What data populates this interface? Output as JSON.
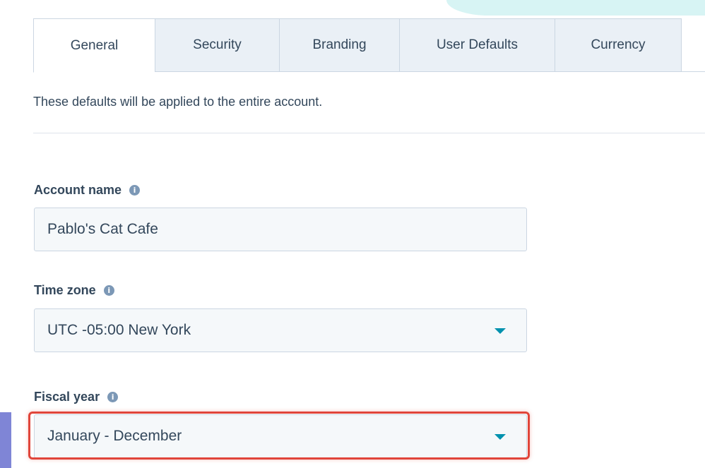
{
  "tabs": [
    {
      "label": "General",
      "active": true
    },
    {
      "label": "Security",
      "active": false
    },
    {
      "label": "Branding",
      "active": false
    },
    {
      "label": "User Defaults",
      "active": false
    },
    {
      "label": "Currency",
      "active": false
    }
  ],
  "intro_text": "These defaults will be applied to the entire account.",
  "account_name": {
    "label": "Account name",
    "value": "Pablo's Cat Cafe",
    "icon": "info-icon"
  },
  "time_zone": {
    "label": "Time zone",
    "value": "UTC -05:00 New York",
    "icon": "info-icon"
  },
  "fiscal_year": {
    "label": "Fiscal year",
    "value": "January - December",
    "icon": "info-icon"
  },
  "colors": {
    "accent": "#0091ae",
    "highlight": "#e0453a",
    "tab_inactive": "#eaf0f6",
    "text": "#33475b"
  }
}
